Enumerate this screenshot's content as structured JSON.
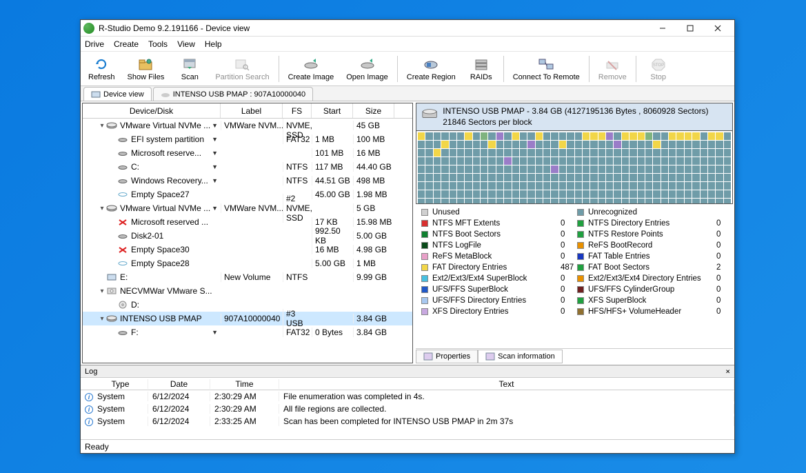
{
  "window": {
    "title": "R-Studio Demo 9.2.191166 - Device view"
  },
  "menu": [
    "Drive",
    "Create",
    "Tools",
    "View",
    "Help"
  ],
  "toolbar": [
    {
      "key": "refresh",
      "label": "Refresh",
      "icon": "refresh",
      "enabled": true
    },
    {
      "key": "showfiles",
      "label": "Show Files",
      "icon": "folder",
      "enabled": true
    },
    {
      "key": "scan",
      "label": "Scan",
      "icon": "scan",
      "enabled": true
    },
    {
      "key": "partsearch",
      "label": "Partition Search",
      "icon": "search",
      "enabled": false
    },
    {
      "key": "sep1",
      "sep": true
    },
    {
      "key": "createimg",
      "label": "Create Image",
      "icon": "diskout",
      "enabled": true
    },
    {
      "key": "openimg",
      "label": "Open Image",
      "icon": "diskin",
      "enabled": true
    },
    {
      "key": "sep2",
      "sep": true
    },
    {
      "key": "region",
      "label": "Create Region",
      "icon": "region",
      "enabled": true
    },
    {
      "key": "raids",
      "label": "RAIDs",
      "icon": "raids",
      "enabled": true
    },
    {
      "key": "sep3",
      "sep": true
    },
    {
      "key": "remote",
      "label": "Connect To Remote",
      "icon": "remote",
      "enabled": true
    },
    {
      "key": "sep4",
      "sep": true
    },
    {
      "key": "remove",
      "label": "Remove",
      "icon": "remove",
      "enabled": false
    },
    {
      "key": "sep5",
      "sep": true
    },
    {
      "key": "stop",
      "label": "Stop",
      "icon": "stop",
      "enabled": false
    }
  ],
  "subtabs": [
    {
      "label": "Device view",
      "icon": "deviceview",
      "active": true
    },
    {
      "label": "INTENSO USB PMAP : 907A10000040",
      "icon": "disk",
      "active": false
    }
  ],
  "tree": {
    "headers": [
      "Device/Disk",
      "Label",
      "FS",
      "Start",
      "Size"
    ],
    "rows": [
      {
        "lvl": 1,
        "exp": "▾",
        "icon": "disk",
        "name": "VMware Virtual NVMe ...",
        "label": "VMWare NVM...",
        "fs": "#1 NVME, SSD",
        "start": "",
        "size": "45 GB",
        "dd": true
      },
      {
        "lvl": 2,
        "icon": "part",
        "name": "EFI system partition",
        "label": "",
        "fs": "FAT32",
        "start": "1 MB",
        "size": "100 MB",
        "dd": true
      },
      {
        "lvl": 2,
        "icon": "part",
        "name": "Microsoft reserve...",
        "label": "",
        "fs": "",
        "start": "101 MB",
        "size": "16 MB",
        "dd": true
      },
      {
        "lvl": 2,
        "icon": "part",
        "name": "C:",
        "label": "",
        "fs": "NTFS",
        "start": "117 MB",
        "size": "44.40 GB",
        "dd": true
      },
      {
        "lvl": 2,
        "icon": "part",
        "name": "Windows Recovery...",
        "label": "",
        "fs": "NTFS",
        "start": "44.51 GB",
        "size": "498 MB",
        "dd": true
      },
      {
        "lvl": 2,
        "icon": "empty",
        "name": "Empty Space27",
        "label": "",
        "fs": "",
        "start": "45.00 GB",
        "size": "1.98 MB"
      },
      {
        "lvl": 1,
        "exp": "▾",
        "icon": "disk",
        "name": "VMware Virtual NVMe ...",
        "label": "VMWare NVM...",
        "fs": "#2 NVME, SSD",
        "start": "",
        "size": "5 GB",
        "dd": true
      },
      {
        "lvl": 2,
        "icon": "bad",
        "name": "Microsoft reserved ...",
        "label": "",
        "fs": "",
        "start": "17 KB",
        "size": "15.98 MB"
      },
      {
        "lvl": 2,
        "icon": "part",
        "name": "Disk2-01",
        "label": "",
        "fs": "",
        "start": "992.50 KB",
        "size": "5.00 GB"
      },
      {
        "lvl": 2,
        "icon": "bad",
        "name": "Empty Space30",
        "label": "",
        "fs": "",
        "start": "16 MB",
        "size": "4.98 GB"
      },
      {
        "lvl": 2,
        "icon": "empty",
        "name": "Empty Space28",
        "label": "",
        "fs": "",
        "start": "5.00 GB",
        "size": "1 MB"
      },
      {
        "lvl": 1,
        "icon": "vol",
        "name": "E:",
        "label": "New Volume",
        "fs": "NTFS",
        "start": "",
        "size": "9.99 GB"
      },
      {
        "lvl": 1,
        "exp": "▾",
        "icon": "cd",
        "name": "NECVMWar VMware S...",
        "label": "",
        "fs": "",
        "start": "",
        "size": ""
      },
      {
        "lvl": 2,
        "icon": "cd2",
        "name": "D:",
        "label": "",
        "fs": "",
        "start": "",
        "size": ""
      },
      {
        "lvl": 1,
        "exp": "▾",
        "icon": "disk",
        "name": "INTENSO USB PMAP",
        "label": "907A10000040",
        "fs": "#3 USB",
        "start": "",
        "size": "3.84 GB",
        "sel": true
      },
      {
        "lvl": 2,
        "icon": "part",
        "name": "F:",
        "label": "",
        "fs": "FAT32",
        "start": "0 Bytes",
        "size": "3.84 GB",
        "dd": true
      }
    ]
  },
  "map": {
    "title": "INTENSO USB PMAP - 3.84 GB (4127195136 Bytes , 8060928 Sectors) 21846 Sectors per block"
  },
  "legend": {
    "left": [
      {
        "color": "#d0d0d0",
        "name": "Unused",
        "val": ""
      },
      {
        "color": "#d83030",
        "name": "NTFS MFT Extents",
        "val": "0"
      },
      {
        "color": "#108030",
        "name": "NTFS Boot Sectors",
        "val": "0"
      },
      {
        "color": "#0a4a1a",
        "name": "NTFS LogFile",
        "val": "0"
      },
      {
        "color": "#e8a0c8",
        "name": "ReFS MetaBlock",
        "val": "0"
      },
      {
        "color": "#f2d648",
        "name": "FAT Directory Entries",
        "val": "487"
      },
      {
        "color": "#48c0e0",
        "name": "Ext2/Ext3/Ext4 SuperBlock",
        "val": "0"
      },
      {
        "color": "#2058c8",
        "name": "UFS/FFS SuperBlock",
        "val": "0"
      },
      {
        "color": "#a8c8f0",
        "name": "UFS/FFS Directory Entries",
        "val": "0"
      },
      {
        "color": "#c8a8e0",
        "name": "XFS Directory Entries",
        "val": "0"
      }
    ],
    "right": [
      {
        "color": "#6f9ca8",
        "name": "Unrecognized",
        "val": ""
      },
      {
        "color": "#20a040",
        "name": "NTFS Directory Entries",
        "val": "0"
      },
      {
        "color": "#20a040",
        "name": "NTFS Restore Points",
        "val": "0"
      },
      {
        "color": "#e89000",
        "name": "ReFS BootRecord",
        "val": "0"
      },
      {
        "color": "#1838c0",
        "name": "FAT Table Entries",
        "val": "0"
      },
      {
        "color": "#20a040",
        "name": "FAT Boot Sectors",
        "val": "2"
      },
      {
        "color": "#e89000",
        "name": "Ext2/Ext3/Ext4 Directory Entries",
        "val": "0"
      },
      {
        "color": "#702020",
        "name": "UFS/FFS CylinderGroup",
        "val": "0"
      },
      {
        "color": "#20a040",
        "name": "XFS SuperBlock",
        "val": "0"
      },
      {
        "color": "#907030",
        "name": "HFS/HFS+ VolumeHeader",
        "val": "0"
      }
    ]
  },
  "rtabs": [
    {
      "label": "Properties",
      "icon": "props",
      "active": false
    },
    {
      "label": "Scan information",
      "icon": "scaninfo",
      "active": true
    }
  ],
  "log": {
    "title": "Log",
    "headers": [
      "Type",
      "Date",
      "Time",
      "Text"
    ],
    "rows": [
      {
        "type": "System",
        "date": "6/12/2024",
        "time": "2:30:29 AM",
        "text": "File enumeration was completed in 4s."
      },
      {
        "type": "System",
        "date": "6/12/2024",
        "time": "2:30:29 AM",
        "text": "All file regions are collected."
      },
      {
        "type": "System",
        "date": "6/12/2024",
        "time": "2:33:25 AM",
        "text": "Scan has been completed for INTENSO USB PMAP in 2m 37s"
      }
    ]
  },
  "status": "Ready"
}
